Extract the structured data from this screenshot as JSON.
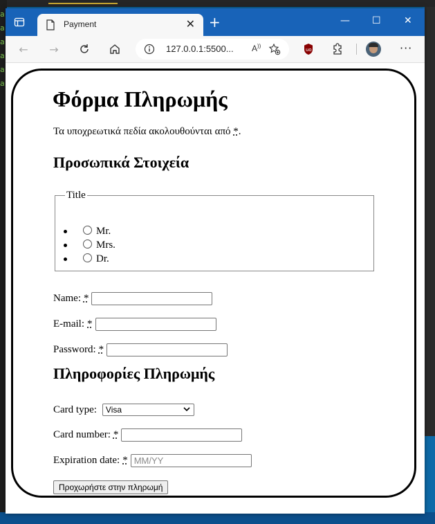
{
  "browser": {
    "tab_title": "Payment",
    "address": "127.0.0.1:5500...",
    "read_aloud": "A⁾"
  },
  "page": {
    "heading": "Φόρμα Πληρωμής",
    "required_note": "Τα υποχρεωτικά πεδία ακολουθούνται από",
    "required_mark": "*",
    "personal_heading": "Προσωπικά Στοιχεία",
    "title_group": {
      "legend": "Title",
      "options": [
        "Mr.",
        "Mrs.",
        "Dr."
      ]
    },
    "name_label": "Name:",
    "email_label": "E-mail:",
    "password_label": "Password:",
    "payment_heading": "Πληροφορίες Πληρωμής",
    "card_type_label": "Card type:",
    "card_type_value": "Visa",
    "card_number_label": "Card number:",
    "expiration_label": "Expiration date:",
    "expiration_placeholder": "MM/YY",
    "submit_label": "Προχωρήστε στην πληρωμή"
  },
  "colors": {
    "titlebar": "#1863b8",
    "desktop": "#0e6aa8"
  }
}
